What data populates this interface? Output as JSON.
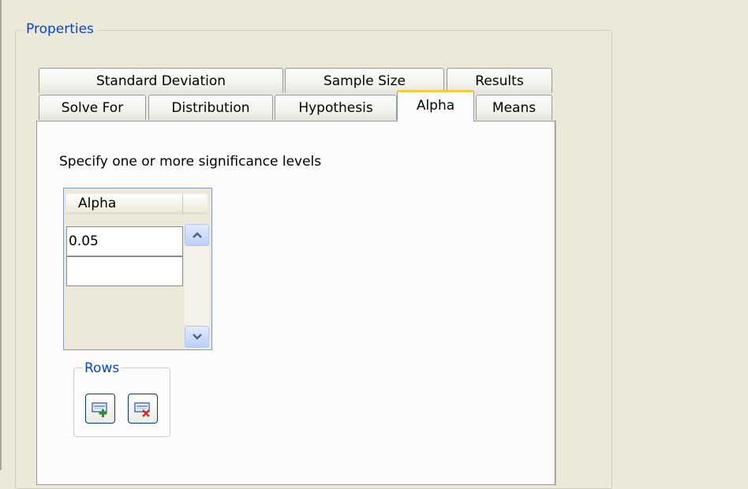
{
  "properties_group": {
    "title": "Properties"
  },
  "tabs": {
    "row_back": [
      {
        "label": "Standard Deviation"
      },
      {
        "label": "Sample Size"
      },
      {
        "label": "Results"
      }
    ],
    "row_front": [
      {
        "label": "Solve For"
      },
      {
        "label": "Distribution"
      },
      {
        "label": "Hypothesis"
      },
      {
        "label": "Alpha",
        "active": true
      },
      {
        "label": "Means"
      }
    ]
  },
  "panel": {
    "instruction": "Specify one or more significance levels",
    "table": {
      "columns": [
        "Alpha"
      ],
      "rows": [
        {
          "value": "0.05"
        },
        {
          "value": ""
        }
      ]
    },
    "rows_group": {
      "title": "Rows",
      "add_icon": "add-row-icon",
      "delete_icon": "delete-row-icon"
    }
  },
  "colors": {
    "group_title": "#0046d5",
    "active_tab_accent": "#ffc83c",
    "background": "#ece9d8"
  }
}
